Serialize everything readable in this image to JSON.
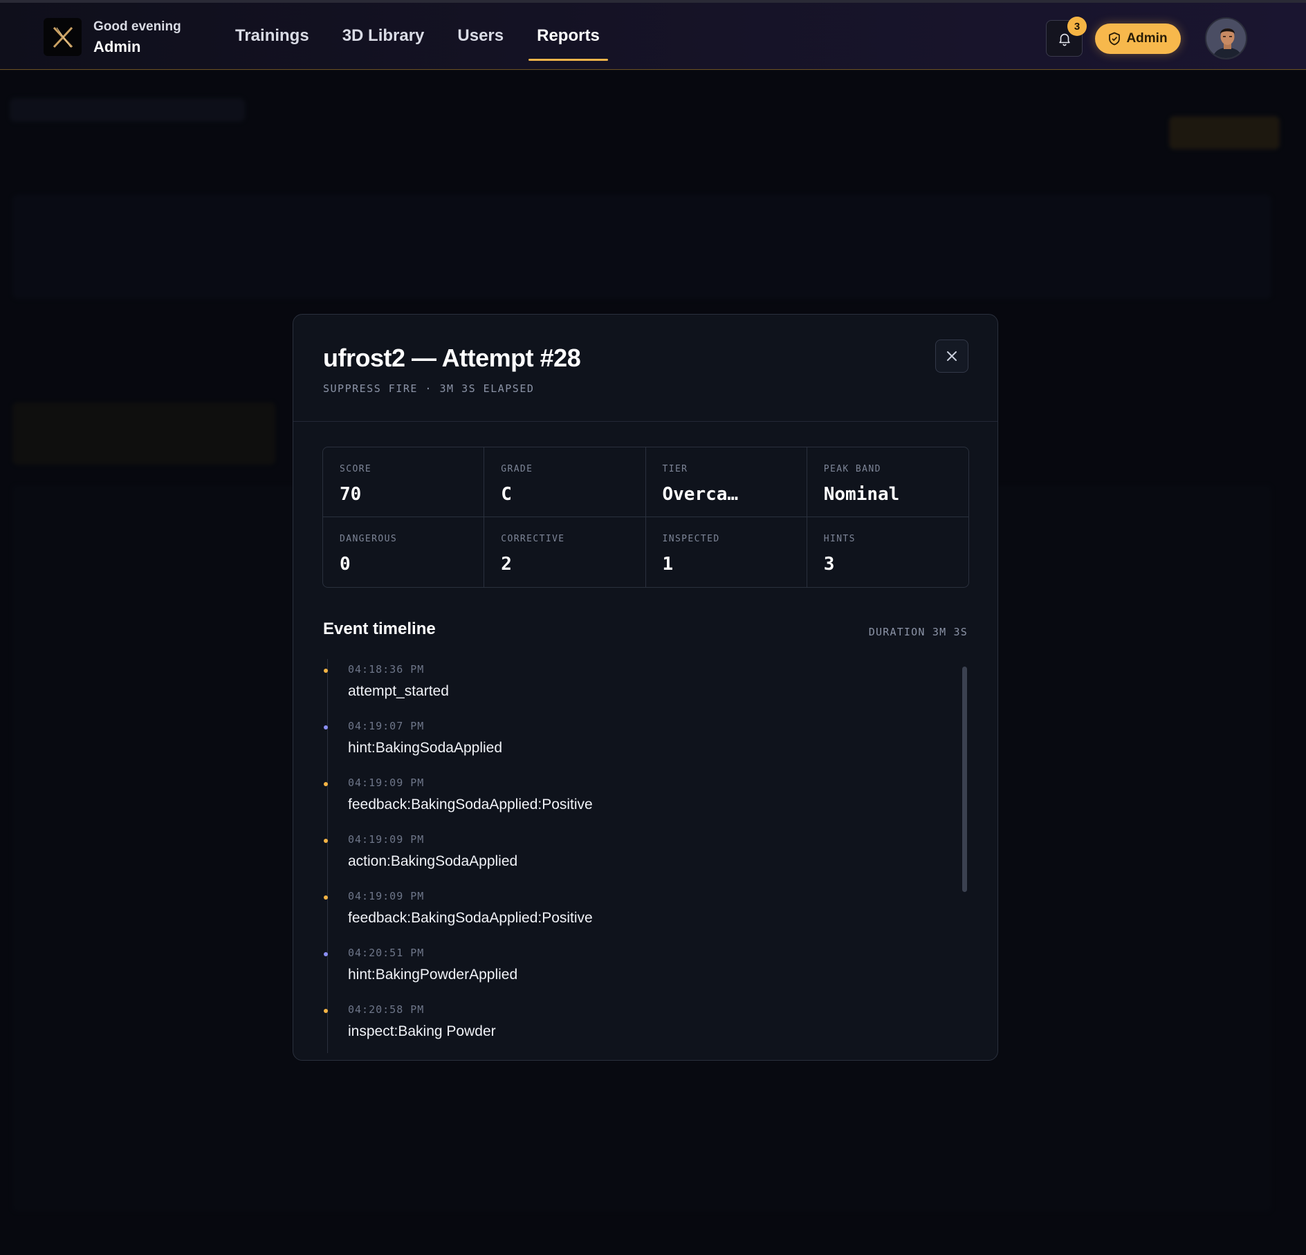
{
  "header": {
    "greeting": "Good evening",
    "user_name": "Admin",
    "nav": [
      {
        "label": "Trainings",
        "active": false
      },
      {
        "label": "3D Library",
        "active": false
      },
      {
        "label": "Users",
        "active": false
      },
      {
        "label": "Reports",
        "active": true
      }
    ],
    "notification_count": "3",
    "role_button_label": "Admin",
    "accent_color": "#f7b84c"
  },
  "modal": {
    "title": "ufrost2 — Attempt #28",
    "subtitle": "SUPPRESS FIRE · 3M 3S ELAPSED",
    "stats": [
      {
        "label": "SCORE",
        "value": "70"
      },
      {
        "label": "GRADE",
        "value": "C"
      },
      {
        "label": "TIER",
        "value": "Overca…"
      },
      {
        "label": "PEAK BAND",
        "value": "Nominal"
      },
      {
        "label": "DANGEROUS",
        "value": "0"
      },
      {
        "label": "CORRECTIVE",
        "value": "2"
      },
      {
        "label": "INSPECTED",
        "value": "1"
      },
      {
        "label": "HINTS",
        "value": "3"
      }
    ],
    "timeline_title": "Event timeline",
    "timeline_duration": "DURATION 3M 3S",
    "events": [
      {
        "time": "04:18:36 PM",
        "event": "attempt_started",
        "dot_color": "#f5b444"
      },
      {
        "time": "04:19:07 PM",
        "event": "hint:BakingSodaApplied",
        "dot_color": "#8b8ff5"
      },
      {
        "time": "04:19:09 PM",
        "event": "feedback:BakingSodaApplied:Positive",
        "dot_color": "#f5b444"
      },
      {
        "time": "04:19:09 PM",
        "event": "action:BakingSodaApplied",
        "dot_color": "#f5b444"
      },
      {
        "time": "04:19:09 PM",
        "event": "feedback:BakingSodaApplied:Positive",
        "dot_color": "#f5b444"
      },
      {
        "time": "04:20:51 PM",
        "event": "hint:BakingPowderApplied",
        "dot_color": "#8b8ff5"
      },
      {
        "time": "04:20:58 PM",
        "event": "inspect:Baking Powder",
        "dot_color": "#f5b444"
      }
    ]
  }
}
